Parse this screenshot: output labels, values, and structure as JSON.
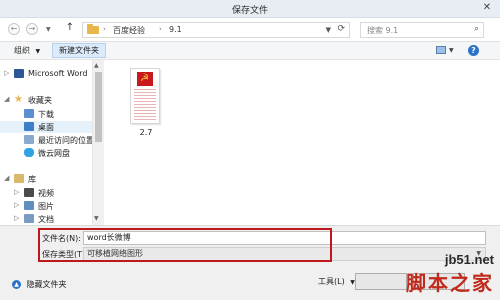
{
  "window": {
    "title": "保存文件"
  },
  "navbar": {
    "breadcrumbs": [
      "百度经验",
      "9.1"
    ],
    "search_placeholder": "搜索 9.1"
  },
  "toolbar": {
    "organize_label": "组织",
    "new_folder_label": "新建文件夹"
  },
  "sidebar": {
    "items": [
      {
        "label": "Microsoft Word",
        "icon": "word-icon"
      },
      {
        "label": "收藏夹",
        "icon": "star-icon"
      },
      {
        "label": "下载",
        "icon": "download-folder-icon"
      },
      {
        "label": "桌面",
        "icon": "desktop-icon"
      },
      {
        "label": "最近访问的位置",
        "icon": "recent-places-icon"
      },
      {
        "label": "微云网盘",
        "icon": "cloud-icon"
      },
      {
        "label": "库",
        "icon": "library-icon"
      },
      {
        "label": "视频",
        "icon": "video-icon"
      },
      {
        "label": "图片",
        "icon": "pictures-icon"
      },
      {
        "label": "文档",
        "icon": "documents-icon"
      }
    ]
  },
  "files": [
    {
      "name": "2.7"
    }
  ],
  "form": {
    "filename_label": "文件名(N):",
    "filename_value": "word长微博",
    "filetype_label": "保存类型(T):",
    "filetype_value": "可移植网络图形"
  },
  "footer": {
    "hide_folders_label": "隐藏文件夹",
    "tools_label": "工具(L)"
  },
  "watermark": {
    "url": "jb51.net",
    "name": "脚本之家"
  },
  "colors": {
    "highlight": "#c0171d",
    "accent": "#2c72c7"
  }
}
